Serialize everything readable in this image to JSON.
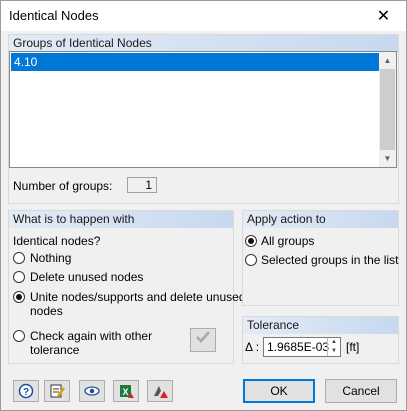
{
  "window": {
    "title": "Identical Nodes",
    "close_glyph": "✕"
  },
  "groups": {
    "header": "Groups of Identical Nodes",
    "items": [
      "4.10"
    ],
    "count_label": "Number of groups:",
    "count_value": "1"
  },
  "what": {
    "header": "What is to happen with",
    "subheader": "Identical nodes?",
    "options": [
      {
        "label": "Nothing",
        "selected": false
      },
      {
        "label": "Delete unused nodes",
        "selected": false
      },
      {
        "label": "Unite nodes/supports and delete unused",
        "label2": "nodes",
        "selected": true
      },
      {
        "label": "Check again with other",
        "label2": "tolerance",
        "selected": false
      }
    ],
    "check_icon": "checkmark-icon"
  },
  "apply": {
    "header": "Apply action to",
    "options": [
      {
        "label": "All groups",
        "selected": true
      },
      {
        "label": "Selected groups in the list",
        "selected": false
      }
    ]
  },
  "tolerance": {
    "header": "Tolerance",
    "symbol": "Δ :",
    "value": "1.9685E-03",
    "unit": "[ft]"
  },
  "footer": {
    "icons": [
      "help-icon",
      "edit-icon",
      "view-icon",
      "excel-export-icon",
      "settings-icon"
    ],
    "ok_label": "OK",
    "cancel_label": "Cancel"
  }
}
